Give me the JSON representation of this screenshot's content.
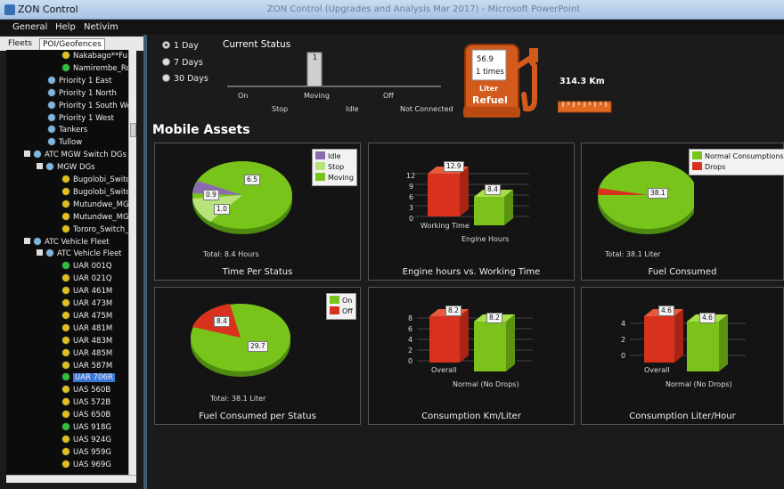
{
  "window": {
    "title": "ZON Control",
    "faded_title": "ZON Control (Upgrades and Analysis Mar 2017) - Microsoft PowerPoint"
  },
  "menu": [
    "General",
    "Help",
    "Netivim"
  ],
  "left_tabs": {
    "fleets": "Fleets",
    "poi": "POI/Geofences"
  },
  "tree": [
    {
      "label": "Nakabago**Fu",
      "color": "#e0c020"
    },
    {
      "label": "Namirembe_Ro",
      "color": "#2fbf3f"
    },
    {
      "label": "Priority 1 East",
      "color": "#7fb6e0"
    },
    {
      "label": "Priority 1 North",
      "color": "#7fb6e0"
    },
    {
      "label": "Priority 1 South We",
      "color": "#7fb6e0"
    },
    {
      "label": "Priority 1 West",
      "color": "#7fb6e0"
    },
    {
      "label": "Tankers",
      "color": "#7fb6e0"
    },
    {
      "label": "Tullow",
      "color": "#7fb6e0"
    },
    {
      "label": "ATC MGW Switch DGs",
      "color": "#7fb6e0"
    },
    {
      "label": "MGW DGs",
      "color": "#7fb6e0"
    },
    {
      "label": "Bugolobi_Switc",
      "color": "#e0c020"
    },
    {
      "label": "Bugolobi_Switc",
      "color": "#e0c020"
    },
    {
      "label": "Mutundwe_MG",
      "color": "#e0c020"
    },
    {
      "label": "Mutundwe_MG",
      "color": "#e0c020"
    },
    {
      "label": "Tororo_Switch_",
      "color": "#e0c020"
    },
    {
      "label": "ATC Vehicle Fleet",
      "color": "#7fb6e0"
    },
    {
      "label": "ATC Vehicle Fleet",
      "color": "#7fb6e0"
    },
    {
      "label": "UAR 001Q",
      "color": "#2fbf3f"
    },
    {
      "label": "UAR 021Q",
      "color": "#e0c020"
    },
    {
      "label": "UAR 461M",
      "color": "#e0c020"
    },
    {
      "label": "UAR 473M",
      "color": "#e0c020"
    },
    {
      "label": "UAR 475M",
      "color": "#e0c020"
    },
    {
      "label": "UAR 481M",
      "color": "#e0c020"
    },
    {
      "label": "UAR 483M",
      "color": "#e0c020"
    },
    {
      "label": "UAR 485M",
      "color": "#e0c020"
    },
    {
      "label": "UAR 587M",
      "color": "#e0c020"
    },
    {
      "label": "UAR 706R",
      "color": "#2fbf3f"
    },
    {
      "label": "UAS 560B",
      "color": "#e0c020"
    },
    {
      "label": "UAS 572B",
      "color": "#e0c020"
    },
    {
      "label": "UAS 650B",
      "color": "#e0c020"
    },
    {
      "label": "UAS 918G",
      "color": "#2fbf3f"
    },
    {
      "label": "UAS 924G",
      "color": "#e0c020"
    },
    {
      "label": "UAS 959G",
      "color": "#e0c020"
    },
    {
      "label": "UAS 969G",
      "color": "#e0c020"
    }
  ],
  "period_options": [
    "1 Day",
    "7 Days",
    "30 Days"
  ],
  "current_status": {
    "title": "Current Status",
    "bar_value": "1",
    "labels_upper": [
      "On",
      "Moving",
      "Off"
    ],
    "labels_lower": [
      "Stop",
      "Idle",
      "Not Connected"
    ]
  },
  "refuel": {
    "amount": "56.9",
    "times": "1 times",
    "unit": "Liter",
    "label": "Refuel"
  },
  "distance": "314.3 Km",
  "section_title": "Mobile Assets",
  "panels": {
    "time_per_status": {
      "title": "Time Per Status",
      "total": "Total: 8.4 Hours",
      "legend": [
        "Idle",
        "Stop",
        "Moving"
      ],
      "labels": [
        "6.5",
        "0.9",
        "1.0"
      ]
    },
    "engine_hours": {
      "title": "Engine hours vs. Working Time",
      "bars": [
        "12.9",
        "8.4"
      ],
      "cats": [
        "Working Time",
        "Engine Hours"
      ],
      "ticks": [
        "12",
        "9",
        "6",
        "3",
        "0"
      ]
    },
    "fuel_consumed": {
      "title": "Fuel Consumed",
      "total": "Total: 38.1 Liter",
      "legend": [
        "Normal Consumptions",
        "Drops"
      ],
      "labels": [
        "38.1"
      ]
    },
    "fuel_per_status": {
      "title": "Fuel Consumed per Status",
      "total": "Total: 38.1 Liter",
      "legend": [
        "On",
        "Off"
      ],
      "labels": [
        "8.4",
        "29.7"
      ]
    },
    "km_per_liter": {
      "title": "Consumption Km/Liter",
      "bars": [
        "8.2",
        "8.2"
      ],
      "cats": [
        "Overall",
        "Normal (No Drops)"
      ],
      "ticks": [
        "8",
        "6",
        "4",
        "2",
        "0"
      ]
    },
    "liter_per_hour": {
      "title": "Consumption Liter/Hour",
      "bars": [
        "4.6",
        "4.6"
      ],
      "cats": [
        "Overall",
        "Normal (No Drops)"
      ],
      "ticks": [
        "4",
        "2",
        "0"
      ]
    }
  },
  "colors": {
    "green": "#7cc21b",
    "red": "#d8321f",
    "purple": "#8b6cb0",
    "light_green": "#b8e27a"
  }
}
